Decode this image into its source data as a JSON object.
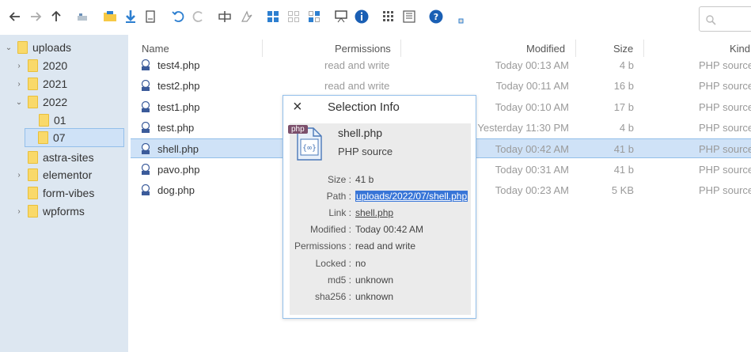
{
  "toolbar": {
    "icons": [
      "back-icon",
      "forward-icon",
      "up-icon",
      "home-icon",
      "open-folder-icon",
      "download-icon",
      "file-icon",
      "undo-icon",
      "redo-icon",
      "rename-icon",
      "resize-icon",
      "select-all-icon",
      "select-none-icon",
      "invert-selection-icon",
      "preview-icon",
      "info-icon",
      "view-icons-icon",
      "view-list-icon",
      "help-icon",
      "fullscreen-icon"
    ]
  },
  "tree": {
    "items": [
      {
        "label": "uploads"
      },
      {
        "label": "2020"
      },
      {
        "label": "2021"
      },
      {
        "label": "2022"
      },
      {
        "label": "01"
      },
      {
        "label": "07"
      },
      {
        "label": "astra-sites"
      },
      {
        "label": "elementor"
      },
      {
        "label": "form-vibes"
      },
      {
        "label": "wpforms"
      }
    ]
  },
  "columns": {
    "name": "Name",
    "permissions": "Permissions",
    "modified": "Modified",
    "size": "Size",
    "kind": "Kind"
  },
  "files": [
    {
      "name": "test4.php",
      "permissions": "read and write",
      "modified": "Today 00:13 AM",
      "size": "4 b",
      "kind": "PHP source"
    },
    {
      "name": "test2.php",
      "permissions": "read and write",
      "modified": "Today 00:11 AM",
      "size": "16 b",
      "kind": "PHP source"
    },
    {
      "name": "test1.php",
      "permissions": "",
      "modified": "Today 00:10 AM",
      "size": "17 b",
      "kind": "PHP source"
    },
    {
      "name": "test.php",
      "permissions": "",
      "modified": "Yesterday 11:30 PM",
      "size": "4 b",
      "kind": "PHP source"
    },
    {
      "name": "shell.php",
      "permissions": "",
      "modified": "Today 00:42 AM",
      "size": "41 b",
      "kind": "PHP source"
    },
    {
      "name": "pavo.php",
      "permissions": "",
      "modified": "Today 00:31 AM",
      "size": "41 b",
      "kind": "PHP source"
    },
    {
      "name": "dog.php",
      "permissions": "",
      "modified": "Today 00:23 AM",
      "size": "5 KB",
      "kind": "PHP source"
    }
  ],
  "dialog": {
    "close": "×",
    "title": "Selection Info",
    "php_tag": "php",
    "file_name": "shell.php",
    "file_type": "PHP source",
    "fields": [
      {
        "key": "Size :",
        "value": "41 b"
      },
      {
        "key": "Path :",
        "value": "uploads/2022/07/shell.php"
      },
      {
        "key": "Link :",
        "value": "shell.php"
      },
      {
        "key": "Modified :",
        "value": "Today 00:42 AM"
      },
      {
        "key": "Permissions :",
        "value": "read and write"
      },
      {
        "key": "Locked :",
        "value": "no"
      },
      {
        "key": "md5 :",
        "value": "unknown"
      },
      {
        "key": "sha256 :",
        "value": "unknown"
      }
    ]
  },
  "colors": {
    "accent": "#3875d7",
    "sidebar_bg": "#dde7f1",
    "selected_bg": "#cfe2f7",
    "folder": "#f9d96a",
    "toolbar_icon": "#2d7fd0"
  }
}
